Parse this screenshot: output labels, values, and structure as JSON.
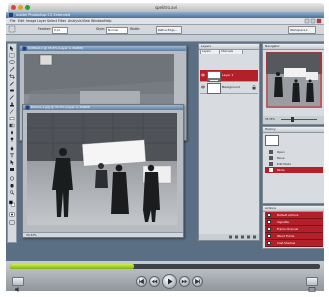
{
  "mac_window": {
    "title": "spektro.avi"
  },
  "photoshop": {
    "title": "Adobe Photoshop CS Extended",
    "menu": [
      "File",
      "Edit",
      "Image",
      "Layer",
      "Select",
      "Filter",
      "Analysis",
      "View",
      "Window",
      "Help"
    ],
    "options": {
      "feather_label": "Feather:",
      "feather_value": "0 px",
      "style_label": "Style:",
      "style_value": "Normal",
      "width_label": "Width:",
      "refine_label": "Refine Edge..."
    },
    "workspace_label": "Workspace ▾"
  },
  "doc_back": {
    "title": "Untitled-1 @ 33,3% (Layer 1, RGB/8)",
    "status": "33,33%"
  },
  "doc_front": {
    "title": "Demos 1.jpg @ 33,3% (Layer 0, RGB/8)",
    "status": "33,33%"
  },
  "layers_panel": {
    "title": "Layers",
    "tabs": [
      "Layers",
      "Channels"
    ],
    "rows": [
      {
        "name": "Layer 1",
        "selected": true
      },
      {
        "name": "Background",
        "selected": false
      }
    ]
  },
  "navigator_panel": {
    "title": "Navigator",
    "zoom": "33,33%"
  },
  "history_panel": {
    "title": "History",
    "rows": [
      {
        "name": "Open",
        "selected": false
      },
      {
        "name": "Move",
        "selected": false
      },
      {
        "name": "Edit Mode",
        "selected": false
      },
      {
        "name": "Paste",
        "selected": true
      }
    ]
  },
  "actions_panel": {
    "title": "Actions",
    "rows": [
      "Default Actions",
      "Vignette",
      "Frame Channel",
      "Wood Frame",
      "Cast Shadow"
    ]
  },
  "player": {
    "progress": 0.4
  },
  "colors": {
    "selection_red": "#b3202a",
    "ps_blue": "#5c7ea5",
    "workspace_bg": "#5a6f84",
    "progress_green": "#9ccd2a"
  }
}
